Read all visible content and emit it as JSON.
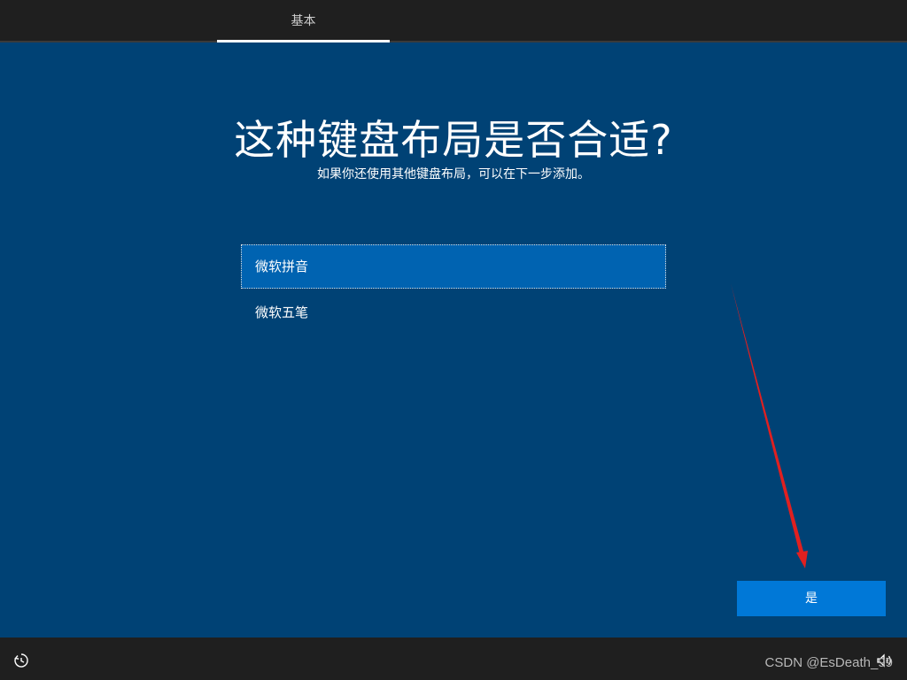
{
  "header": {
    "tabs": [
      {
        "label": "基本",
        "active": true
      }
    ]
  },
  "main": {
    "title": "这种键盘布局是否合适?",
    "subtitle": "如果你还使用其他键盘布局，可以在下一步添加。",
    "layouts": [
      {
        "label": "微软拼音",
        "selected": true
      },
      {
        "label": "微软五笔",
        "selected": false
      }
    ],
    "confirm_label": "是"
  },
  "footer": {
    "left_icon": "ease-of-access-icon",
    "right_icon": "volume-icon",
    "watermark": "CSDN @EsDeath_99"
  },
  "colors": {
    "background": "#004275",
    "bar": "#1f1f1f",
    "selected_item": "#0063b1",
    "button": "#0078d7",
    "annotation_arrow": "#e02020"
  }
}
